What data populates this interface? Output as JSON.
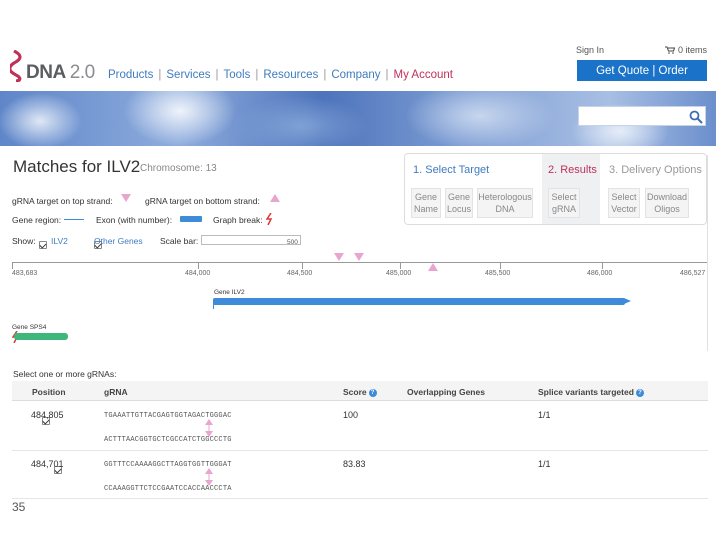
{
  "brand": {
    "name": "DNA",
    "version": "2.0"
  },
  "nav": [
    "Products",
    "Services",
    "Tools",
    "Resources",
    "Company",
    "My Account"
  ],
  "top": {
    "signin": "Sign In",
    "cart": "0 items",
    "quote": "Get Quote | Order"
  },
  "title": {
    "main": "Matches for ILV2",
    "chromosome": "Chromosome: 13"
  },
  "steps": {
    "step1": "1. Select Target",
    "step2": "2. Results",
    "step3": "3. Delivery Options",
    "b_gene_name": [
      "Gene",
      "Name"
    ],
    "b_gene_locus": [
      "Gene",
      "Locus"
    ],
    "b_hetero": [
      "Heterologous",
      "DNA"
    ],
    "b_select_grna": [
      "Select",
      "gRNA"
    ],
    "b_select_vector": [
      "Select",
      "Vector"
    ],
    "b_download": [
      "Download",
      "Oligos"
    ]
  },
  "legend": {
    "top_strand": "gRNA target on top strand:",
    "bottom_strand": "gRNA target on bottom strand:",
    "gene_region": "Gene region:",
    "exon": "Exon (with number):",
    "graph_break": "Graph break:",
    "show": "Show:",
    "ilv2": "ILV2",
    "other_genes": "Other Genes",
    "scale_bar": "Scale bar:",
    "scale_value": "500"
  },
  "ruler": [
    "483,683",
    "484,000",
    "484,500",
    "485,000",
    "485,500",
    "486,000",
    "486,527"
  ],
  "tracks": {
    "ilv2": "Gene ILV2",
    "sps4": "Gene SPS4"
  },
  "table": {
    "select_label": "Select one or more gRNAs:",
    "headers": {
      "position": "Position",
      "grna": "gRNA",
      "score": "Score",
      "overlap": "Overlapping Genes",
      "splice": "Splice variants targeted"
    },
    "rows": [
      {
        "position": "484,805",
        "seq_top": "TGAAATTGTTACGAGTGGTAGACTGGGAC",
        "seq_bottom": "ACTTTAACGGTGCTCGCCATCTGGCCCTG",
        "score": "100",
        "overlap": "",
        "splice": "1/1"
      },
      {
        "position": "484,701",
        "seq_top": "GGTTTCCAAAAGGCTTAGGTGGTTGGGAT",
        "seq_bottom": "CCAAAGGTTCTCCGAATCCACCAACCCTA",
        "score": "83.83",
        "overlap": "",
        "splice": "1/1"
      }
    ]
  },
  "slide_number": "35",
  "colors": {
    "accent": "#1a73c9",
    "brand_red": "#c0315a",
    "gene_blue": "#3d8bd9",
    "gene_green": "#3fb77a",
    "marker_pink": "#e8a5cf"
  }
}
